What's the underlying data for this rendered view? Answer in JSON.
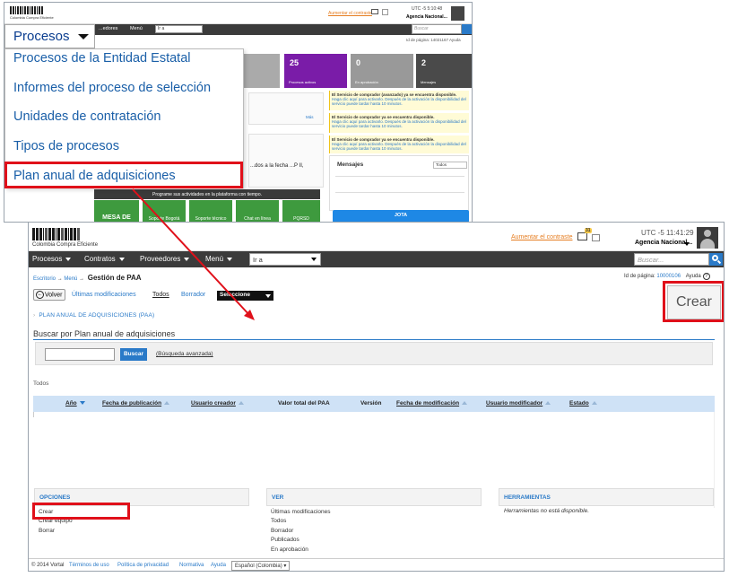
{
  "back_window": {
    "logo_caption": "Colombia Compra Eficiente",
    "contrast_link": "Aumentar el contraste",
    "utc": "UTC -5 5:10:48",
    "agency": "Agencia Nacional...",
    "nav": [
      "...edores",
      "Menú",
      "Ir a"
    ],
    "search_placeholder": "Buscar",
    "page_id": "Id de página: 14021167  Ayuda",
    "tiles": [
      {
        "value": "25",
        "label": "Procesos activos",
        "color": "#7a1ca8"
      },
      {
        "value": "0",
        "label": "En aprobación",
        "color": "#999999"
      },
      {
        "value": "2",
        "label": "Mensajes",
        "color": "#4a4a4a"
      }
    ],
    "alerts": [
      {
        "title": "El Servicio de comprador (avanzado) ya se encuentra disponible.",
        "text": "Haga clic aquí para activarlo. Después de la activación la disponibilidad del servicio puede tardar hasta 10 minutos."
      },
      {
        "title": "El Servicio de comprador ya se encuentra disponible.",
        "text": "Haga clic aquí para activarlo. Después de la activación la disponibilidad del servicio puede tardar hasta 10 minutos."
      },
      {
        "title": "El Servicio de comprador ya se encuentra disponible.",
        "text": "Haga clic aquí para activarlo. Después de la activación la disponibilidad del servicio puede tardar hasta 10 minutos."
      }
    ],
    "mensajes_title": "Mensajes",
    "mensajes_filter": "Todos",
    "jota_label": "JOTA",
    "activity_banner": "Programe sus actividades en la plataforma con tiempo.",
    "green_tiles": [
      "MESA DE",
      "Soporte Bogotá",
      "Soporte técnico",
      "Chat en línea",
      "PQRSD"
    ],
    "snippet": "...dos a la fecha ...P II,",
    "mas": "Más"
  },
  "dropdown": {
    "trigger_label": "Procesos",
    "items": [
      "Procesos de la Entidad Estatal",
      "Informes del proceso de selección",
      "Unidades de contratación",
      "Tipos de procesos",
      "Plan anual de adquisiciones"
    ],
    "highlighted_index": 4
  },
  "main": {
    "logo_caption": "Colombia Compra Eficiente",
    "contrast_link": "Aumentar el contraste",
    "mail_badge": "31",
    "utc": "UTC -5 11:41:29",
    "agency": "Agencia Nacional...",
    "nav": {
      "procesos": "Procesos",
      "contratos": "Contratos",
      "proveedores": "Proveedores",
      "menu": "Menú",
      "ir_a": "Ir a"
    },
    "search_placeholder": "Buscar...",
    "breadcrumb": {
      "escritorio": "Escritorio",
      "sep": "→",
      "menu": "Menú",
      "page": "Gestión de PAA"
    },
    "page_id_label": "Id de página:",
    "page_id_value": "10000106",
    "help_label": "Ayuda",
    "toolbar": {
      "back": "Volver",
      "ultimas": "Últimas modificaciones",
      "todos": "Todos",
      "borrador": "Borrador",
      "seleccione": "Seleccione"
    },
    "crear_button": "Crear",
    "paa_section": "PLAN ANUAL DE ADQUISICIONES (PAA)",
    "search_title": "Buscar por Plan anual de adquisiciones",
    "search_button": "Buscar",
    "advanced_search": "(Búsqueda avanzada)",
    "todos_label": "Todos",
    "columns": [
      {
        "label": "Año",
        "sortable": true,
        "sort": "desc"
      },
      {
        "label": "Fecha de publicación",
        "sortable": true
      },
      {
        "label": "Usuario creador",
        "sortable": true
      },
      {
        "label": "Valor total del PAA",
        "sortable": false
      },
      {
        "label": "Versión",
        "sortable": false
      },
      {
        "label": "Fecha de modificación",
        "sortable": true
      },
      {
        "label": "Usuario modificador",
        "sortable": true
      },
      {
        "label": "Estado",
        "sortable": true
      }
    ],
    "opciones": {
      "title": "OPCIONES",
      "items": [
        "Crear",
        "Crear equipo",
        "Borrar"
      ]
    },
    "ver": {
      "title": "VER",
      "items": [
        "Últimas modificaciones",
        "Todos",
        "Borrador",
        "Publicados",
        "En aprobación"
      ]
    },
    "herramientas": {
      "title": "HERRAMIENTAS",
      "note": "Herramientas no está disponible."
    },
    "footer": {
      "copyright": "© 2014 Vortal",
      "terms": "Términos de uso",
      "privacy": "Política de privacidad",
      "rules": "Normativa",
      "help": "Ayuda",
      "language": "Español (Colombia)"
    }
  },
  "colors": {
    "highlight": "#e0101a",
    "link": "#2a7ac8",
    "navbar": "#3b3b3b",
    "grid_header": "#cfe2f6"
  }
}
